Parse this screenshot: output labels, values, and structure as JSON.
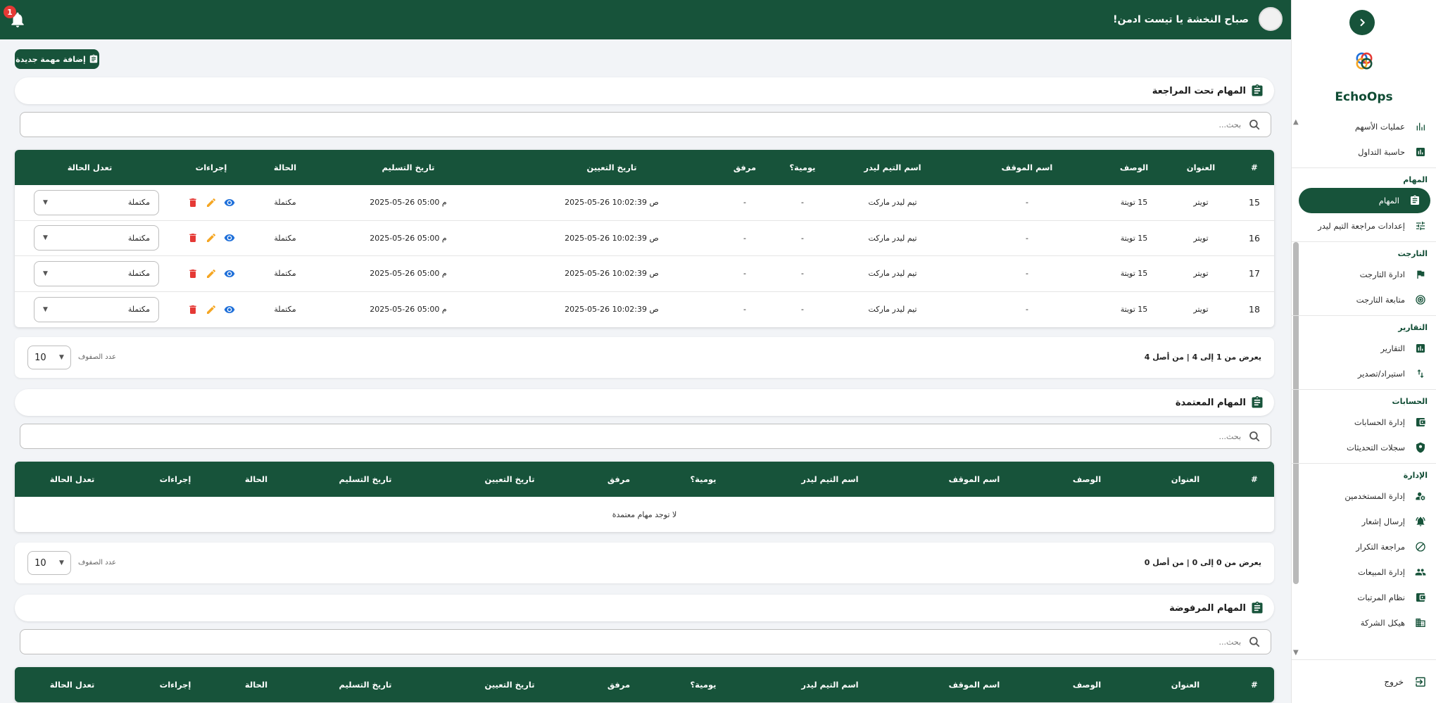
{
  "header": {
    "greeting": "صباح النخشة يا تيست ادمن!",
    "notification_count": "1"
  },
  "sidebar": {
    "brand": "EchoOps",
    "sections": [
      {
        "title": "",
        "items": [
          {
            "label": "عمليات الأسهم",
            "icon": "bar-chart-icon"
          },
          {
            "label": "حاسبة التداول",
            "icon": "analytics-icon"
          }
        ]
      },
      {
        "title": "المهام",
        "items": [
          {
            "label": "المهام",
            "icon": "clipboard-icon",
            "active": true
          },
          {
            "label": "إعدادات مراجعة التيم ليدر",
            "icon": "sliders-icon"
          }
        ]
      },
      {
        "title": "التارجت",
        "items": [
          {
            "label": "ادارة التارجت",
            "icon": "flag-icon"
          },
          {
            "label": "متابعة التارجت",
            "icon": "target-icon"
          }
        ]
      },
      {
        "title": "التقارير",
        "items": [
          {
            "label": "التقارير",
            "icon": "report-icon"
          },
          {
            "label": "استيراد/تصدير",
            "icon": "import-export-icon"
          }
        ]
      },
      {
        "title": "الحسابات",
        "items": [
          {
            "label": "إدارة الحسابات",
            "icon": "wallet-icon"
          },
          {
            "label": "سجلات التحديثات",
            "icon": "shield-icon"
          }
        ]
      },
      {
        "title": "الإدارة",
        "items": [
          {
            "label": "إدارة المستخدمين",
            "icon": "user-settings-icon"
          },
          {
            "label": "إرسال إشعار",
            "icon": "bell-ring-icon"
          },
          {
            "label": "مراجعة التكرار",
            "icon": "block-icon"
          },
          {
            "label": "إدارة المبيعات",
            "icon": "group-icon"
          },
          {
            "label": "نظام المرتبات",
            "icon": "wallet-icon"
          },
          {
            "label": "هيكل الشركة",
            "icon": "building-icon"
          }
        ]
      }
    ],
    "logout": "خروج"
  },
  "toolbar": {
    "add_task": "إضافة مهمة جديدة"
  },
  "columns": {
    "num": "#",
    "title": "العنوان",
    "desc": "الوصف",
    "location": "اسم الموقف",
    "leader": "اسم التيم ليدر",
    "daily": "يومية؟",
    "attachment": "مرفق",
    "assign_date": "تاريخ التعيين",
    "delivery_date": "تاريخ التسليم",
    "status": "الحالة",
    "actions": "إجراءات",
    "change_status": "تعدل الحالة"
  },
  "search_placeholder": "بحث...",
  "rows_label": "عدد الصفوف",
  "review": {
    "title": "المهام تحت المراجعة",
    "rows": [
      {
        "num": "15",
        "title": "تويتر",
        "desc": "15 تويتة",
        "location": "-",
        "leader": "تيم ليدر ماركت",
        "daily": "-",
        "attachment": "-",
        "assign_date": "2025-05-26 10:02:39 ص",
        "delivery_date": "2025-05-26 05:00 م",
        "status": "مكتملة",
        "select": "مكتملة"
      },
      {
        "num": "16",
        "title": "تويتر",
        "desc": "15 تويتة",
        "location": "-",
        "leader": "تيم ليدر ماركت",
        "daily": "-",
        "attachment": "-",
        "assign_date": "2025-05-26 10:02:39 ص",
        "delivery_date": "2025-05-26 05:00 م",
        "status": "مكتملة",
        "select": "مكتملة"
      },
      {
        "num": "17",
        "title": "تويتر",
        "desc": "15 تويتة",
        "location": "-",
        "leader": "تيم ليدر ماركت",
        "daily": "-",
        "attachment": "-",
        "assign_date": "2025-05-26 10:02:39 ص",
        "delivery_date": "2025-05-26 05:00 م",
        "status": "مكتملة",
        "select": "مكتملة"
      },
      {
        "num": "18",
        "title": "تويتر",
        "desc": "15 تويتة",
        "location": "-",
        "leader": "تيم ليدر ماركت",
        "daily": "-",
        "attachment": "-",
        "assign_date": "2025-05-26 10:02:39 ص",
        "delivery_date": "2025-05-26 05:00 م",
        "status": "مكتملة",
        "select": "مكتملة"
      }
    ],
    "pager_info": "يعرض من 1 إلى 4 | من أصل 4",
    "page_size": "10"
  },
  "approved": {
    "title": "المهام المعتمدة",
    "empty": "لا توجد مهام معتمدة",
    "pager_info": "يعرض من 0 إلى 0 | من أصل 0",
    "page_size": "10"
  },
  "rejected": {
    "title": "المهام المرفوضة"
  },
  "colors": {
    "primary": "#17533a",
    "delete": "#e53935",
    "edit": "#f5a623",
    "view": "#1e6fd9"
  }
}
